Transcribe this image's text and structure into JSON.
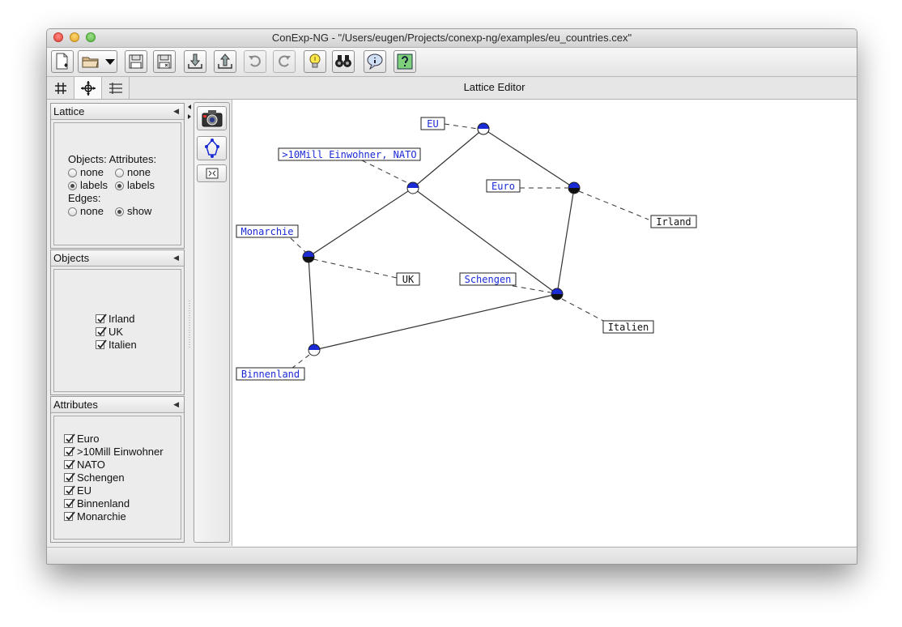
{
  "window": {
    "title": "ConExp-NG - \"/Users/eugen/Projects/conexp-ng/examples/eu_countries.cex\""
  },
  "toolbar": {
    "buttons": [
      {
        "icon": "new-document-icon"
      },
      {
        "icon": "open-folder-icon"
      },
      {
        "icon": "dropdown-arrow-icon"
      },
      {
        "icon": "save-icon"
      },
      {
        "icon": "save-as-icon"
      },
      {
        "icon": "import-icon"
      },
      {
        "icon": "export-icon"
      },
      {
        "icon": "undo-icon"
      },
      {
        "icon": "redo-icon"
      },
      {
        "icon": "lightbulb-icon"
      },
      {
        "icon": "binoculars-icon"
      },
      {
        "icon": "info-bubble-icon"
      },
      {
        "icon": "help-icon"
      }
    ]
  },
  "tabs": {
    "items": [
      {
        "icon": "context-grid-icon"
      },
      {
        "icon": "lattice-crosshair-icon"
      },
      {
        "icon": "implications-list-icon"
      }
    ],
    "editor_title": "Lattice Editor"
  },
  "lattice_panel": {
    "header": "Lattice",
    "objects_label": "Objects:",
    "attributes_label": "Attributes:",
    "none_label": "none",
    "labels_label": "labels",
    "edges_label": "Edges:",
    "show_label": "show",
    "objects_selected": "labels",
    "attributes_selected": "labels",
    "edges_selected": "show"
  },
  "objects_panel": {
    "header": "Objects",
    "items": [
      "Irland",
      "UK",
      "Italien"
    ]
  },
  "attributes_panel": {
    "header": "Attributes",
    "items": [
      "Euro",
      ">10Mill Einwohner",
      "NATO",
      "Schengen",
      "EU",
      "Binnenland",
      "Monarchie"
    ]
  },
  "lattice": {
    "attribute_labels": {
      "eu": "EU",
      "mill_nato": ">10Mill Einwohner, NATO",
      "euro": "Euro",
      "monarchie": "Monarchie",
      "schengen": "Schengen",
      "binnenland": "Binnenland"
    },
    "object_labels": {
      "irland": "Irland",
      "uk": "UK",
      "italien": "Italien"
    },
    "colors": {
      "attribute_text": "#1a2bd6",
      "node_top": "#1a2bd6",
      "node_bottom_object": "#111111",
      "edge": "#333333"
    }
  }
}
